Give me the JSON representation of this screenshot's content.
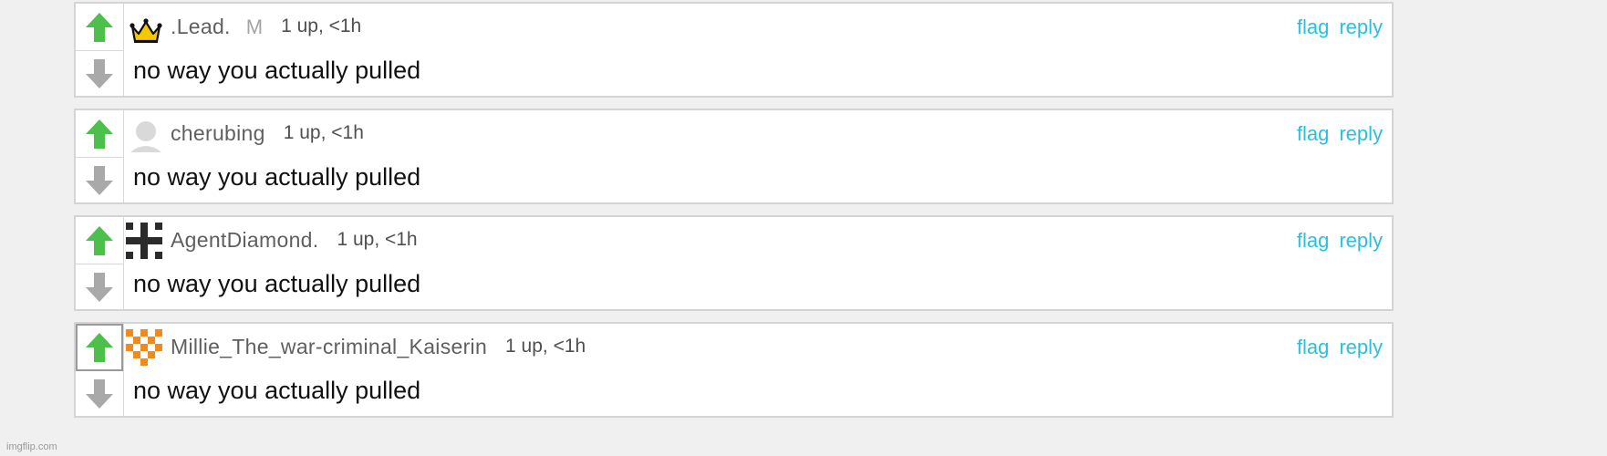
{
  "colors": {
    "upvote": "#4cc04a",
    "downvote": "#a9a9a9",
    "link": "#29c0e0",
    "username": "#5f5f5f"
  },
  "comments": [
    {
      "username": ".Lead.",
      "badge": "M",
      "stats": "1 up, <1h",
      "text": "no way you actually pulled",
      "flag": "flag",
      "reply": "reply",
      "avatar_icon": "crown-icon"
    },
    {
      "username": "cherubing",
      "badge": "",
      "stats": "1 up, <1h",
      "text": "no way you actually pulled",
      "flag": "flag",
      "reply": "reply",
      "avatar_icon": "default-user-icon"
    },
    {
      "username": "AgentDiamond.",
      "badge": "",
      "stats": "1 up, <1h",
      "text": "no way you actually pulled",
      "flag": "flag",
      "reply": "reply",
      "avatar_icon": "pixel-cross-icon"
    },
    {
      "username": "Millie_The_war-criminal_Kaiserin",
      "badge": "",
      "stats": "1 up, <1h",
      "text": "no way you actually pulled",
      "flag": "flag",
      "reply": "reply",
      "avatar_icon": "orange-pixel-icon"
    }
  ],
  "watermark": "imgflip.com"
}
